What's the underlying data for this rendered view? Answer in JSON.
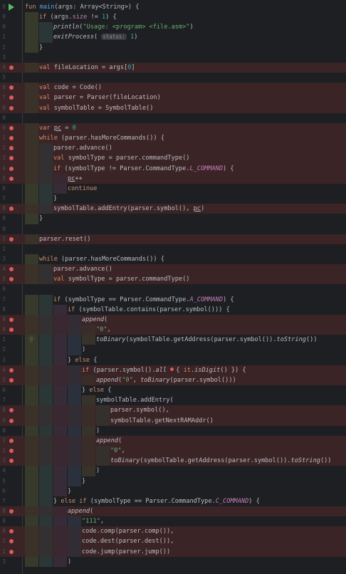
{
  "editor": {
    "language": "Kotlin",
    "colors": {
      "background": "#1e1f22",
      "breakpoint_line": "#3b2426",
      "breakpoint_dot": "#db5c5c",
      "keyword": "#cf8e6d",
      "function": "#56a8f5",
      "string": "#6aab73",
      "number": "#2aacb8",
      "property": "#c77dbb"
    },
    "lines": [
      {
        "no": "8",
        "bp": false,
        "run": true,
        "indent": 0,
        "tokens": [
          [
            "kw",
            "fun "
          ],
          [
            "fn",
            "main"
          ],
          [
            "",
            "(args: Array<String>) {"
          ]
        ]
      },
      {
        "no": "9",
        "bp": false,
        "indent": 1,
        "tokens": [
          [
            "kw",
            "if "
          ],
          [
            "",
            "(args."
          ],
          [
            "pc",
            "size"
          ],
          [
            "",
            " != "
          ],
          [
            "num",
            "1"
          ],
          [
            "",
            ") {"
          ]
        ]
      },
      {
        "no": "0",
        "bp": false,
        "indent": 2,
        "tokens": [
          [
            "it",
            "println"
          ],
          [
            "",
            "("
          ],
          [
            "str",
            "\"Usage: <program> <file.asm>\""
          ],
          [
            "",
            ")"
          ]
        ]
      },
      {
        "no": "1",
        "bp": false,
        "indent": 2,
        "tokens": [
          [
            "it",
            "exitProcess"
          ],
          [
            "",
            "( "
          ],
          [
            "hint",
            "status:"
          ],
          [
            "",
            " "
          ],
          [
            "num",
            "1"
          ],
          [
            "",
            ")"
          ]
        ]
      },
      {
        "no": "2",
        "bp": false,
        "indent": 1,
        "tokens": [
          [
            "",
            "}"
          ]
        ]
      },
      {
        "no": "3",
        "bp": false,
        "indent": 0,
        "tokens": []
      },
      {
        "no": "4",
        "bp": true,
        "indent": 1,
        "tokens": [
          [
            "kw",
            "val "
          ],
          [
            "",
            "fileLocation = args["
          ],
          [
            "num",
            "0"
          ],
          [
            "",
            "]"
          ]
        ]
      },
      {
        "no": "5",
        "bp": false,
        "indent": 0,
        "tokens": []
      },
      {
        "no": "6",
        "bp": true,
        "indent": 1,
        "tokens": [
          [
            "kw",
            "val "
          ],
          [
            "",
            "code = Code()"
          ]
        ]
      },
      {
        "no": "7",
        "bp": true,
        "indent": 1,
        "tokens": [
          [
            "kw",
            "val "
          ],
          [
            "",
            "parser = Parser(fileLocation)"
          ]
        ]
      },
      {
        "no": "8",
        "bp": true,
        "indent": 1,
        "tokens": [
          [
            "kw",
            "val "
          ],
          [
            "",
            "symbolTable = SymbolTable()"
          ]
        ]
      },
      {
        "no": "9",
        "bp": false,
        "indent": 0,
        "tokens": []
      },
      {
        "no": "0",
        "bp": true,
        "indent": 1,
        "tokens": [
          [
            "kw",
            "var "
          ],
          [
            "mut",
            "pc"
          ],
          [
            "",
            " = "
          ],
          [
            "num",
            "0"
          ]
        ]
      },
      {
        "no": "1",
        "bp": true,
        "indent": 1,
        "tokens": [
          [
            "kw",
            "while "
          ],
          [
            "",
            "(parser.hasMoreCommands()) {"
          ]
        ]
      },
      {
        "no": "2",
        "bp": true,
        "indent": 2,
        "tokens": [
          [
            "",
            "parser.advance()"
          ]
        ]
      },
      {
        "no": "3",
        "bp": true,
        "indent": 2,
        "tokens": [
          [
            "kw",
            "val "
          ],
          [
            "",
            "symbolType = parser.commandType()"
          ]
        ]
      },
      {
        "no": "4",
        "bp": true,
        "indent": 2,
        "tokens": [
          [
            "kw",
            "if "
          ],
          [
            "",
            "(symbolType != Parser.CommandType."
          ],
          [
            "cst",
            "L_COMMAND"
          ],
          [
            "",
            ") {"
          ]
        ]
      },
      {
        "no": "5",
        "bp": true,
        "indent": 3,
        "tokens": [
          [
            "mut",
            "pc"
          ],
          [
            "",
            "++"
          ]
        ]
      },
      {
        "no": "6",
        "bp": false,
        "indent": 3,
        "tokens": [
          [
            "kw",
            "continue"
          ]
        ]
      },
      {
        "no": "7",
        "bp": false,
        "indent": 2,
        "tokens": [
          [
            "",
            "}"
          ]
        ]
      },
      {
        "no": "8",
        "bp": true,
        "indent": 2,
        "tokens": [
          [
            "",
            "symbolTable.addEntry(parser.symbol(), "
          ],
          [
            "mut",
            "pc"
          ],
          [
            "",
            ")"
          ]
        ]
      },
      {
        "no": "9",
        "bp": false,
        "indent": 1,
        "tokens": [
          [
            "",
            "}"
          ]
        ]
      },
      {
        "no": "0",
        "bp": false,
        "indent": 0,
        "tokens": []
      },
      {
        "no": "1",
        "bp": true,
        "indent": 1,
        "tokens": [
          [
            "",
            "parser.reset()"
          ]
        ]
      },
      {
        "no": "2",
        "bp": false,
        "indent": 0,
        "tokens": []
      },
      {
        "no": "3",
        "bp": false,
        "indent": 1,
        "tokens": [
          [
            "kw",
            "while "
          ],
          [
            "",
            "(parser.hasMoreCommands()) {"
          ]
        ]
      },
      {
        "no": "4",
        "bp": true,
        "indent": 2,
        "tokens": [
          [
            "",
            "parser.advance()"
          ]
        ]
      },
      {
        "no": "5",
        "bp": true,
        "indent": 2,
        "tokens": [
          [
            "kw",
            "val "
          ],
          [
            "",
            "symbolType = parser.commandType()"
          ]
        ]
      },
      {
        "no": "6",
        "bp": false,
        "indent": 0,
        "tokens": []
      },
      {
        "no": "7",
        "bp": false,
        "indent": 2,
        "tokens": [
          [
            "kw",
            "if "
          ],
          [
            "",
            "(symbolType == Parser.CommandType."
          ],
          [
            "cst",
            "A_COMMAND"
          ],
          [
            "",
            ") {"
          ]
        ]
      },
      {
        "no": "8",
        "bp": false,
        "indent": 3,
        "tokens": [
          [
            "kw",
            "if "
          ],
          [
            "",
            "(symbolTable.contains(parser.symbol())) {"
          ]
        ]
      },
      {
        "no": "9",
        "bp": true,
        "indent": 4,
        "tokens": [
          [
            "it",
            "append"
          ],
          [
            "",
            "("
          ]
        ]
      },
      {
        "no": "0",
        "bp": true,
        "indent": 5,
        "tokens": [
          [
            "str",
            "\"0\""
          ],
          [
            "",
            ","
          ]
        ]
      },
      {
        "no": "1",
        "bp": false,
        "bulb": true,
        "indent": 5,
        "tokens": [
          [
            "it",
            "toBinary"
          ],
          [
            "",
            "(symbolTable.getAddress(parser.symbol())."
          ],
          [
            "it",
            "toString"
          ],
          [
            "",
            "())"
          ]
        ]
      },
      {
        "no": "2",
        "bp": false,
        "indent": 4,
        "tokens": [
          [
            "",
            ")"
          ]
        ]
      },
      {
        "no": "3",
        "bp": false,
        "indent": 3,
        "tokens": [
          [
            "",
            "} "
          ],
          [
            "kw",
            "else "
          ],
          [
            "",
            "{"
          ]
        ]
      },
      {
        "no": "4",
        "bp": true,
        "indent": 4,
        "tokens": [
          [
            "kw",
            "if "
          ],
          [
            "",
            "(parser.symbol()."
          ],
          [
            "it",
            "all "
          ],
          [
            "dot",
            ""
          ],
          [
            "",
            "{ "
          ],
          [
            "kw",
            "it"
          ],
          [
            "",
            "."
          ],
          [
            "it",
            "isDigit"
          ],
          [
            "",
            "() }) {"
          ]
        ]
      },
      {
        "no": "5",
        "bp": true,
        "indent": 5,
        "tokens": [
          [
            "it",
            "append"
          ],
          [
            "",
            "("
          ],
          [
            "str",
            "\"0\""
          ],
          [
            "",
            ", "
          ],
          [
            "it",
            "toBinary"
          ],
          [
            "",
            "(parser.symbol()))"
          ]
        ]
      },
      {
        "no": "6",
        "bp": false,
        "indent": 4,
        "tokens": [
          [
            "",
            "} "
          ],
          [
            "kw",
            "else "
          ],
          [
            "",
            "{"
          ]
        ]
      },
      {
        "no": "7",
        "bp": false,
        "indent": 5,
        "tokens": [
          [
            "",
            "symbolTable.addEntry("
          ]
        ]
      },
      {
        "no": "8",
        "bp": true,
        "indent": 6,
        "tokens": [
          [
            "",
            "parser.symbol(),"
          ]
        ]
      },
      {
        "no": "9",
        "bp": true,
        "indent": 6,
        "tokens": [
          [
            "",
            "symbolTable.getNextRAMAddr()"
          ]
        ]
      },
      {
        "no": "0",
        "bp": false,
        "indent": 5,
        "tokens": [
          [
            "",
            ")"
          ]
        ]
      },
      {
        "no": "1",
        "bp": true,
        "indent": 5,
        "tokens": [
          [
            "it",
            "append"
          ],
          [
            "",
            "("
          ]
        ]
      },
      {
        "no": "2",
        "bp": true,
        "indent": 6,
        "tokens": [
          [
            "str",
            "\"0\""
          ],
          [
            "",
            ","
          ]
        ]
      },
      {
        "no": "3",
        "bp": true,
        "indent": 6,
        "tokens": [
          [
            "it",
            "toBinary"
          ],
          [
            "",
            "(symbolTable.getAddress(parser.symbol())."
          ],
          [
            "it",
            "toString"
          ],
          [
            "",
            "())"
          ]
        ]
      },
      {
        "no": "4",
        "bp": false,
        "indent": 5,
        "tokens": [
          [
            "",
            ")"
          ]
        ]
      },
      {
        "no": "5",
        "bp": false,
        "indent": 4,
        "tokens": [
          [
            "",
            "}"
          ]
        ]
      },
      {
        "no": "6",
        "bp": false,
        "indent": 3,
        "tokens": [
          [
            "",
            "}"
          ]
        ]
      },
      {
        "no": "7",
        "bp": false,
        "indent": 2,
        "tokens": [
          [
            "",
            "} "
          ],
          [
            "kw",
            "else if "
          ],
          [
            "",
            "(symbolType == Parser.CommandType."
          ],
          [
            "cst",
            "C_COMMAND"
          ],
          [
            "",
            ") {"
          ]
        ]
      },
      {
        "no": "8",
        "bp": true,
        "indent": 3,
        "tokens": [
          [
            "it",
            "append"
          ],
          [
            "",
            "("
          ]
        ]
      },
      {
        "no": "9",
        "bp": false,
        "indent": 4,
        "tokens": [
          [
            "str",
            "\"111\""
          ],
          [
            "",
            ","
          ]
        ]
      },
      {
        "no": "0",
        "bp": true,
        "indent": 4,
        "tokens": [
          [
            "",
            "code.comp(parser.comp()),"
          ]
        ]
      },
      {
        "no": "1",
        "bp": true,
        "indent": 4,
        "tokens": [
          [
            "",
            "code.dest(parser.dest()),"
          ]
        ]
      },
      {
        "no": "2",
        "bp": true,
        "indent": 4,
        "tokens": [
          [
            "",
            "code.jump(parser.jump())"
          ]
        ]
      },
      {
        "no": "3",
        "bp": false,
        "indent": 3,
        "tokens": [
          [
            "",
            ")"
          ]
        ]
      }
    ]
  }
}
